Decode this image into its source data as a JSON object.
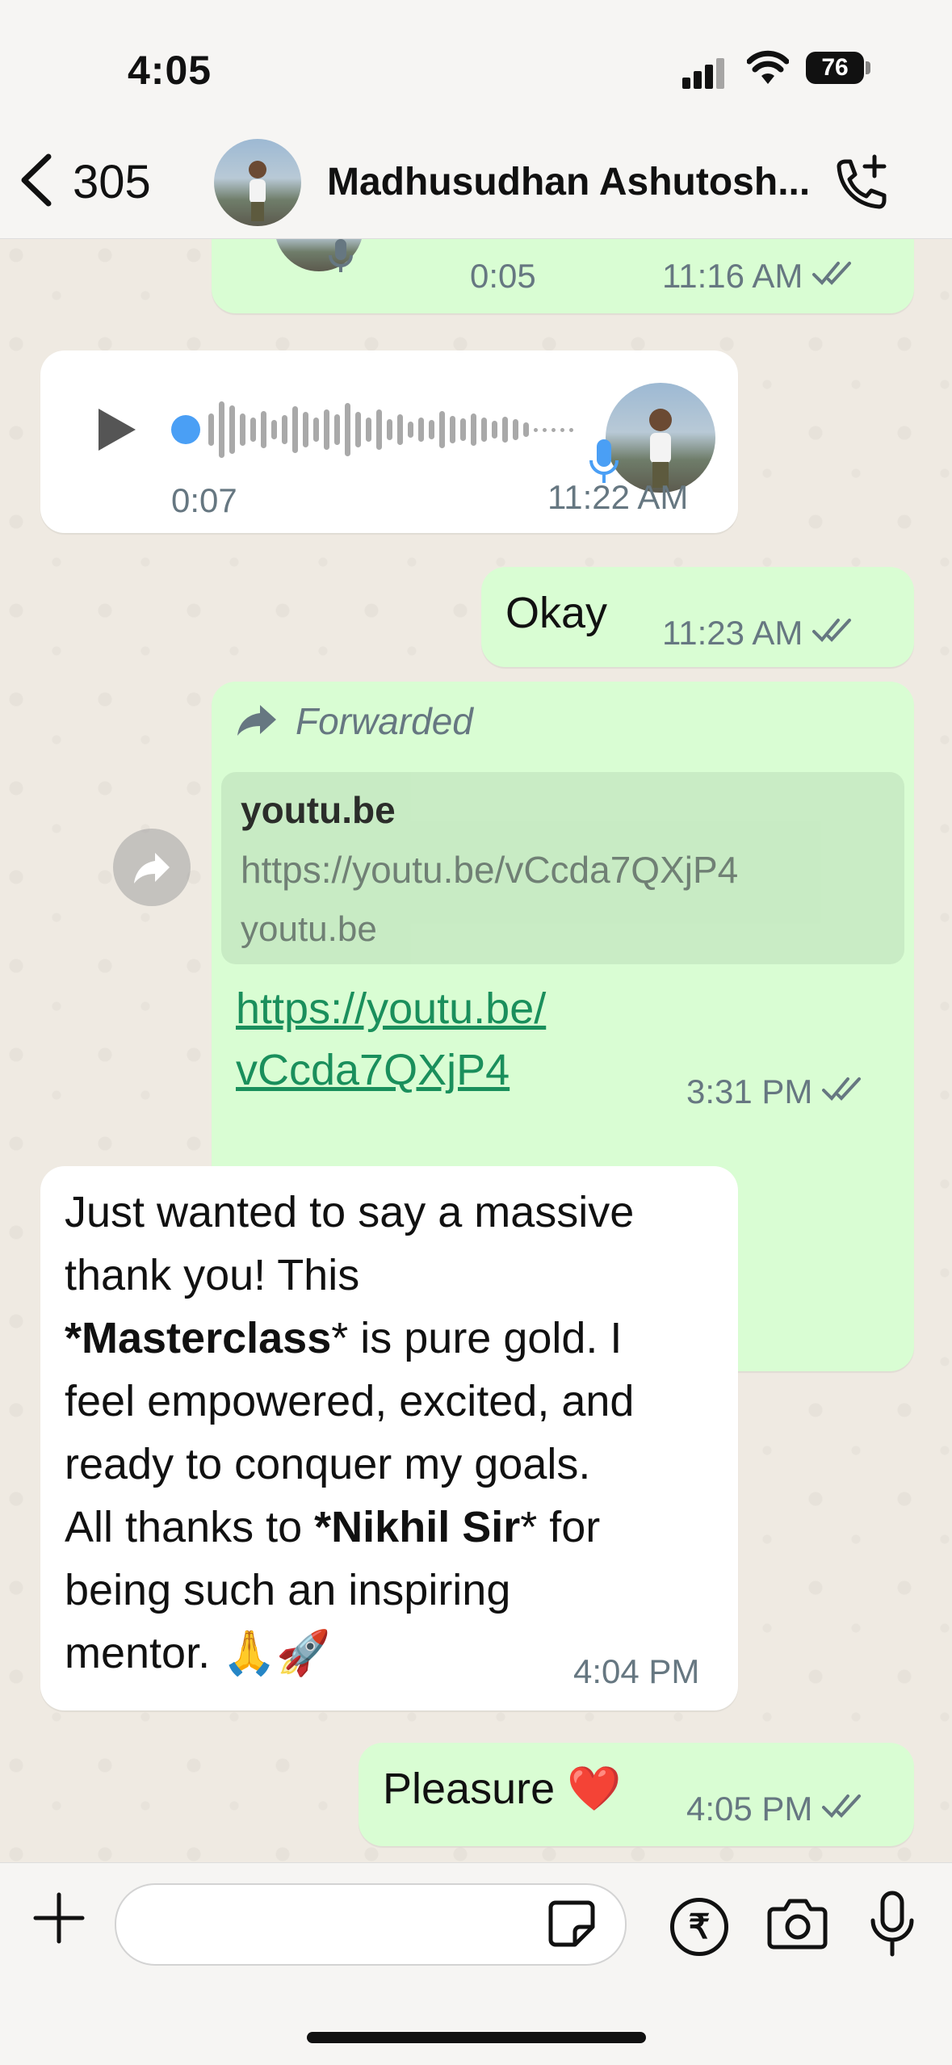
{
  "status_bar": {
    "time": "4:05",
    "battery": "76"
  },
  "header": {
    "back_count": "305",
    "contact_name": "Madhusudhan Ashutosh..."
  },
  "messages": [
    {
      "type": "voice",
      "direction": "outgoing",
      "duration": "0:05",
      "time": "11:16 AM",
      "status": "read"
    },
    {
      "type": "voice",
      "direction": "incoming",
      "duration": "0:07",
      "time": "11:22 AM"
    },
    {
      "type": "text",
      "direction": "outgoing",
      "text": "Okay",
      "time": "11:23 AM",
      "status": "read"
    },
    {
      "type": "link",
      "direction": "outgoing",
      "forwarded_label": "Forwarded",
      "preview_title": "youtu.be",
      "preview_url": "https://youtu.be/vCcda7QXjP4",
      "preview_domain": "youtu.be",
      "link_line1": "https://youtu.be/",
      "link_line2": "vCcda7QXjP4",
      "time": "3:31 PM",
      "status": "read"
    },
    {
      "type": "text",
      "direction": "incoming",
      "lines": [
        "Just wanted to say a massive",
        "thank you! This",
        "*Masterclass* is pure gold. I",
        "feel empowered, excited, and",
        "ready to conquer my goals.",
        "All thanks to *Nikhil Sir* for",
        "being such an inspiring",
        "mentor. 🙏🚀"
      ],
      "time": "4:04 PM"
    },
    {
      "type": "text",
      "direction": "outgoing",
      "text": "Pleasure ❤️",
      "time": "4:05 PM",
      "status": "read"
    }
  ],
  "icons": {
    "back": "chevron-left-icon",
    "call_add": "phone-plus-icon",
    "play": "play-icon",
    "mic_badge": "microphone-icon",
    "forward": "forward-icon",
    "ticks": "double-check-icon",
    "attach": "plus-icon",
    "sticker": "sticker-icon",
    "payment": "rupee-icon",
    "camera": "camera-icon",
    "mic": "microphone-icon"
  },
  "colors": {
    "outgoing_bubble": "#d9fdd3",
    "incoming_bubble": "#ffffff",
    "chat_bg": "#efeae2",
    "link": "#1a8f5c",
    "voice_dot": "#4a9ff5"
  }
}
